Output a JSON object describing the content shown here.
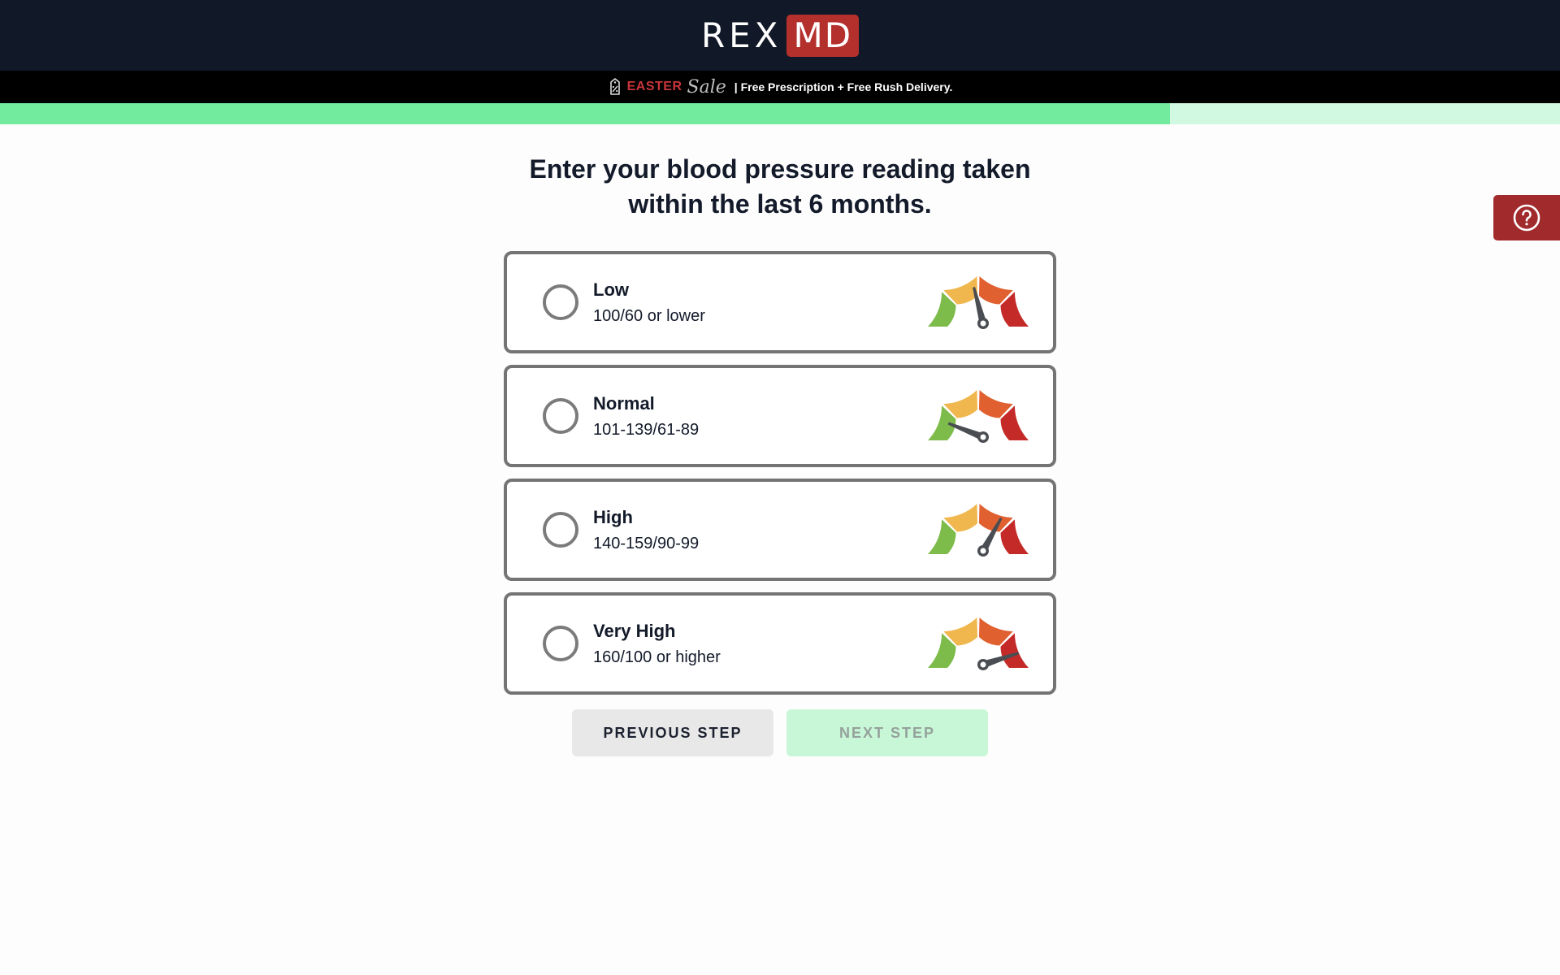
{
  "header": {
    "logo_left": "REX",
    "logo_right": "MD",
    "logo_accent_color": "#b4302d"
  },
  "promo": {
    "icon": "percent-tag-icon",
    "easter": "EASTER",
    "sale": "Sale",
    "message": "| Free Prescription + Free Rush Delivery."
  },
  "progress": {
    "percent": 75,
    "fill_color": "#73eb9e",
    "track_color": "#d1f8e0"
  },
  "help": {
    "icon": "question-circle-icon",
    "color": "#a12b2c"
  },
  "question": {
    "title": "Enter your blood pressure reading taken within the last 6 months."
  },
  "options": [
    {
      "label": "Low",
      "range": "100/60 or lower",
      "gauge_level": 0.42,
      "selected": false
    },
    {
      "label": "Normal",
      "range": "101-139/61-89",
      "gauge_level": 0.12,
      "selected": false
    },
    {
      "label": "High",
      "range": "140-159/90-99",
      "gauge_level": 0.66,
      "selected": false
    },
    {
      "label": "Very High",
      "range": "160/100 or higher",
      "gauge_level": 0.9,
      "selected": false
    }
  ],
  "gauge_colors": [
    "#7dbb4a",
    "#f1b74f",
    "#e0602f",
    "#c42b28"
  ],
  "buttons": {
    "previous": "PREVIOUS STEP",
    "next": "NEXT STEP",
    "next_disabled": true
  }
}
